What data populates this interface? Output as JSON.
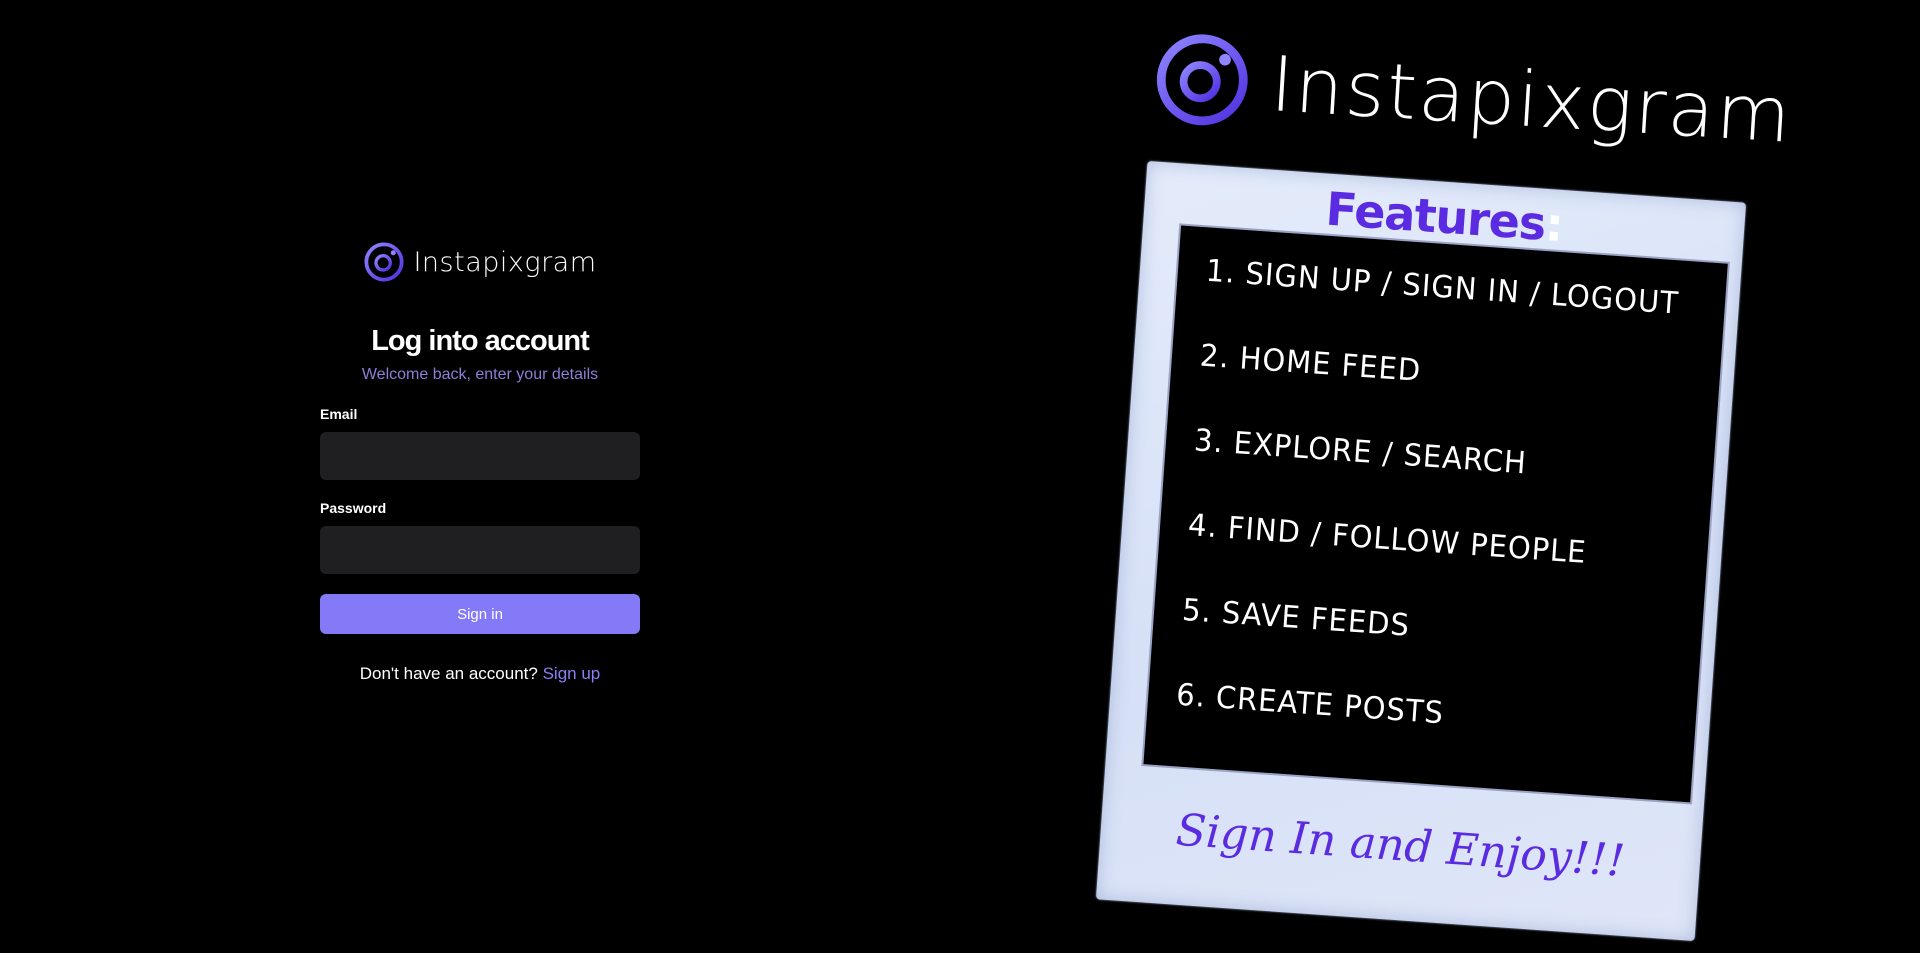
{
  "app": {
    "name": "Instapixgram"
  },
  "login": {
    "brand_name": "Instapixgram",
    "title": "Log into account",
    "subtitle": "Welcome back, enter your details",
    "email_label": "Email",
    "email_value": "",
    "password_label": "Password",
    "password_value": "",
    "signin_label": "Sign in",
    "signup_prompt": "Don't have an account?",
    "signup_link": "Sign up"
  },
  "promo": {
    "brand_name": "Instapixgram",
    "features_title": "Features",
    "features_colon": ":",
    "features": [
      {
        "num": "1.",
        "text": "Sign up / Sign in / Logout"
      },
      {
        "num": "2.",
        "text": "Home feed"
      },
      {
        "num": "3.",
        "text": "Explore / Search"
      },
      {
        "num": "4.",
        "text": "Find / Follow people"
      },
      {
        "num": "5.",
        "text": "Save feeds"
      },
      {
        "num": "6.",
        "text": "Create posts"
      }
    ],
    "tagline": "Sign In and Enjoy!!!"
  },
  "icons": {
    "logo": "instapixgram-logo-icon"
  },
  "colors": {
    "background": "#000000",
    "accent": "#8479f6",
    "subtitle": "#8b7fd6",
    "input_bg": "#1f1f22",
    "promo_purple": "#5a2be0",
    "polaroid_frame": "#dfe6f8"
  }
}
